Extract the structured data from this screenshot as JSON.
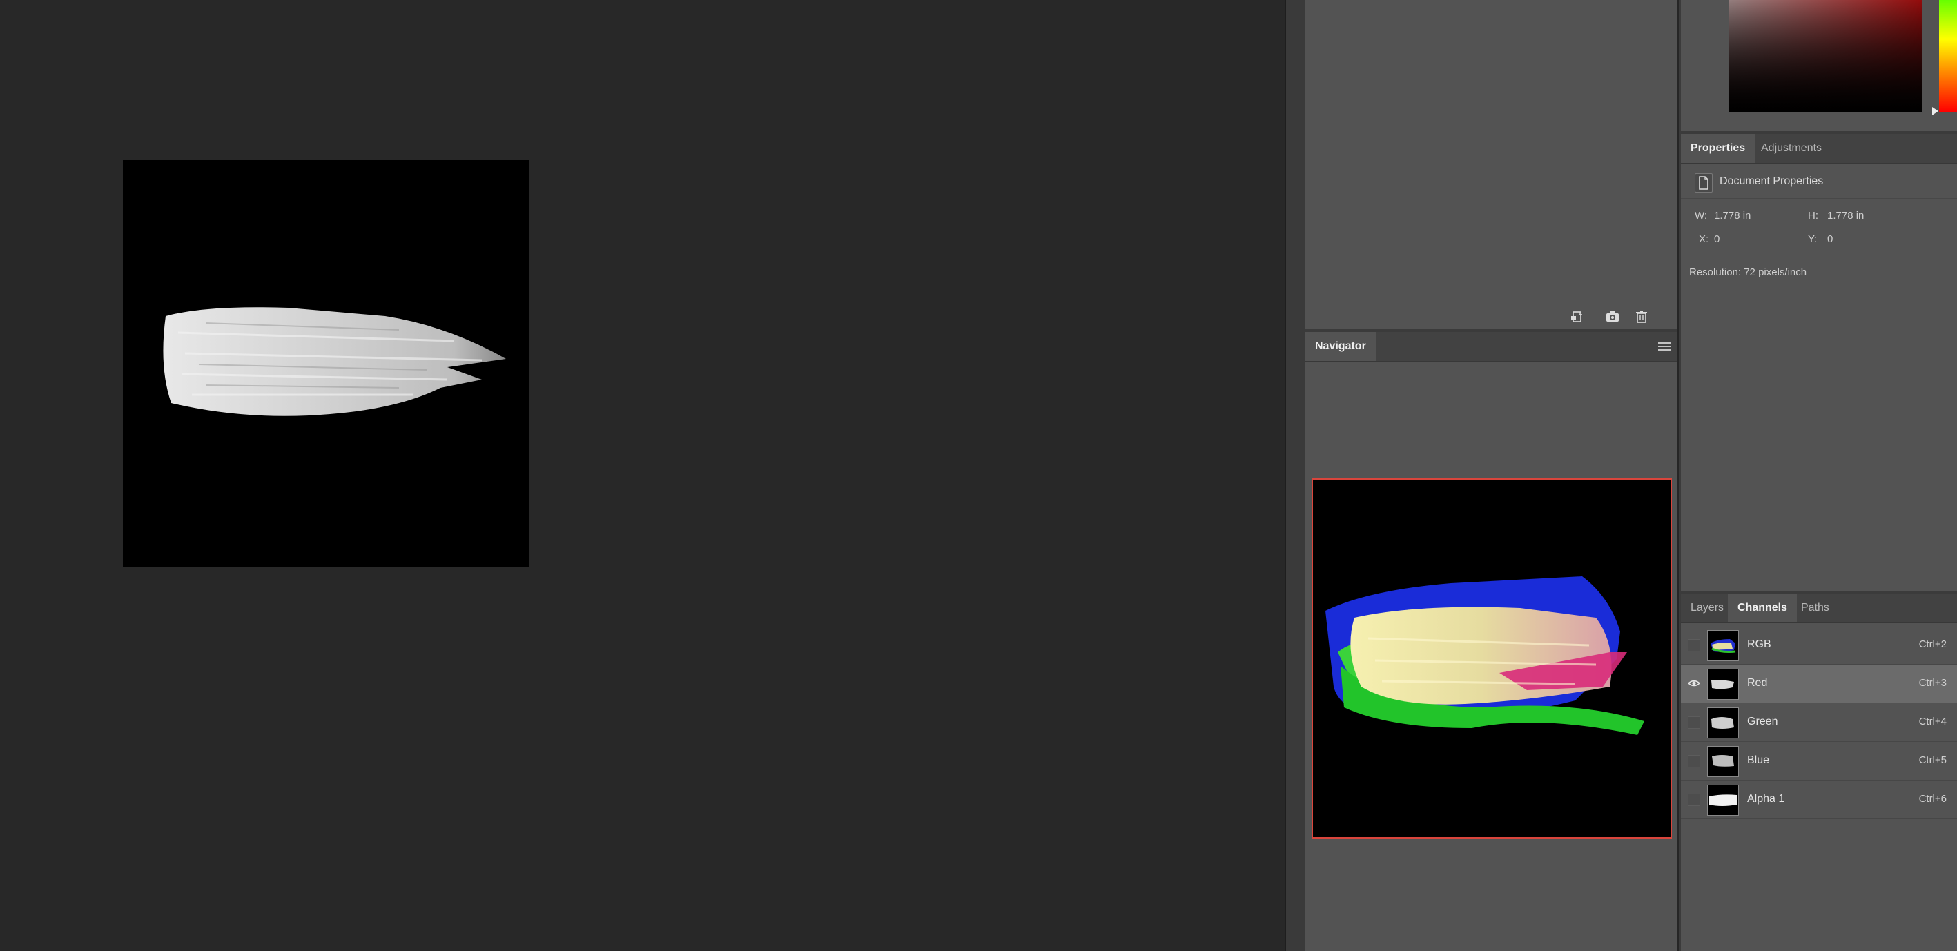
{
  "history_panel": {
    "icons": [
      "new-document-from-state-icon",
      "camera-snapshot-icon",
      "trash-icon"
    ]
  },
  "navigator": {
    "tab_label": "Navigator",
    "menu_icon": "hamburger-menu-icon",
    "view_box_color": "#d9453c"
  },
  "color_panel": {
    "hue_marker_icon": "triangle-marker-icon"
  },
  "properties": {
    "tabs": [
      "Properties",
      "Adjustments"
    ],
    "active_tab": "Properties",
    "header_icon": "document-icon",
    "header_title": "Document Properties",
    "w_label": "W:",
    "w_value": "1.778 in",
    "h_label": "H:",
    "h_value": "1.778 in",
    "x_label": "X:",
    "x_value": "0",
    "y_label": "Y:",
    "y_value": "0",
    "resolution": "Resolution: 72 pixels/inch"
  },
  "layers_panel": {
    "tabs": [
      "Layers",
      "Channels",
      "Paths"
    ],
    "active_tab": "Channels",
    "channels": [
      {
        "name": "RGB",
        "shortcut": "Ctrl+2",
        "visible": false,
        "selected": false,
        "thumb": "color"
      },
      {
        "name": "Red",
        "shortcut": "Ctrl+3",
        "visible": true,
        "selected": true,
        "thumb": "gray"
      },
      {
        "name": "Green",
        "shortcut": "Ctrl+4",
        "visible": false,
        "selected": false,
        "thumb": "gray"
      },
      {
        "name": "Blue",
        "shortcut": "Ctrl+5",
        "visible": false,
        "selected": false,
        "thumb": "gray"
      },
      {
        "name": "Alpha 1",
        "shortcut": "Ctrl+6",
        "visible": false,
        "selected": false,
        "thumb": "white"
      }
    ]
  },
  "colors": {
    "workspace_bg": "#282828",
    "panel_bg": "#535353",
    "tab_bar_bg": "#424242",
    "selected_row_bg": "#6b6b6b"
  }
}
